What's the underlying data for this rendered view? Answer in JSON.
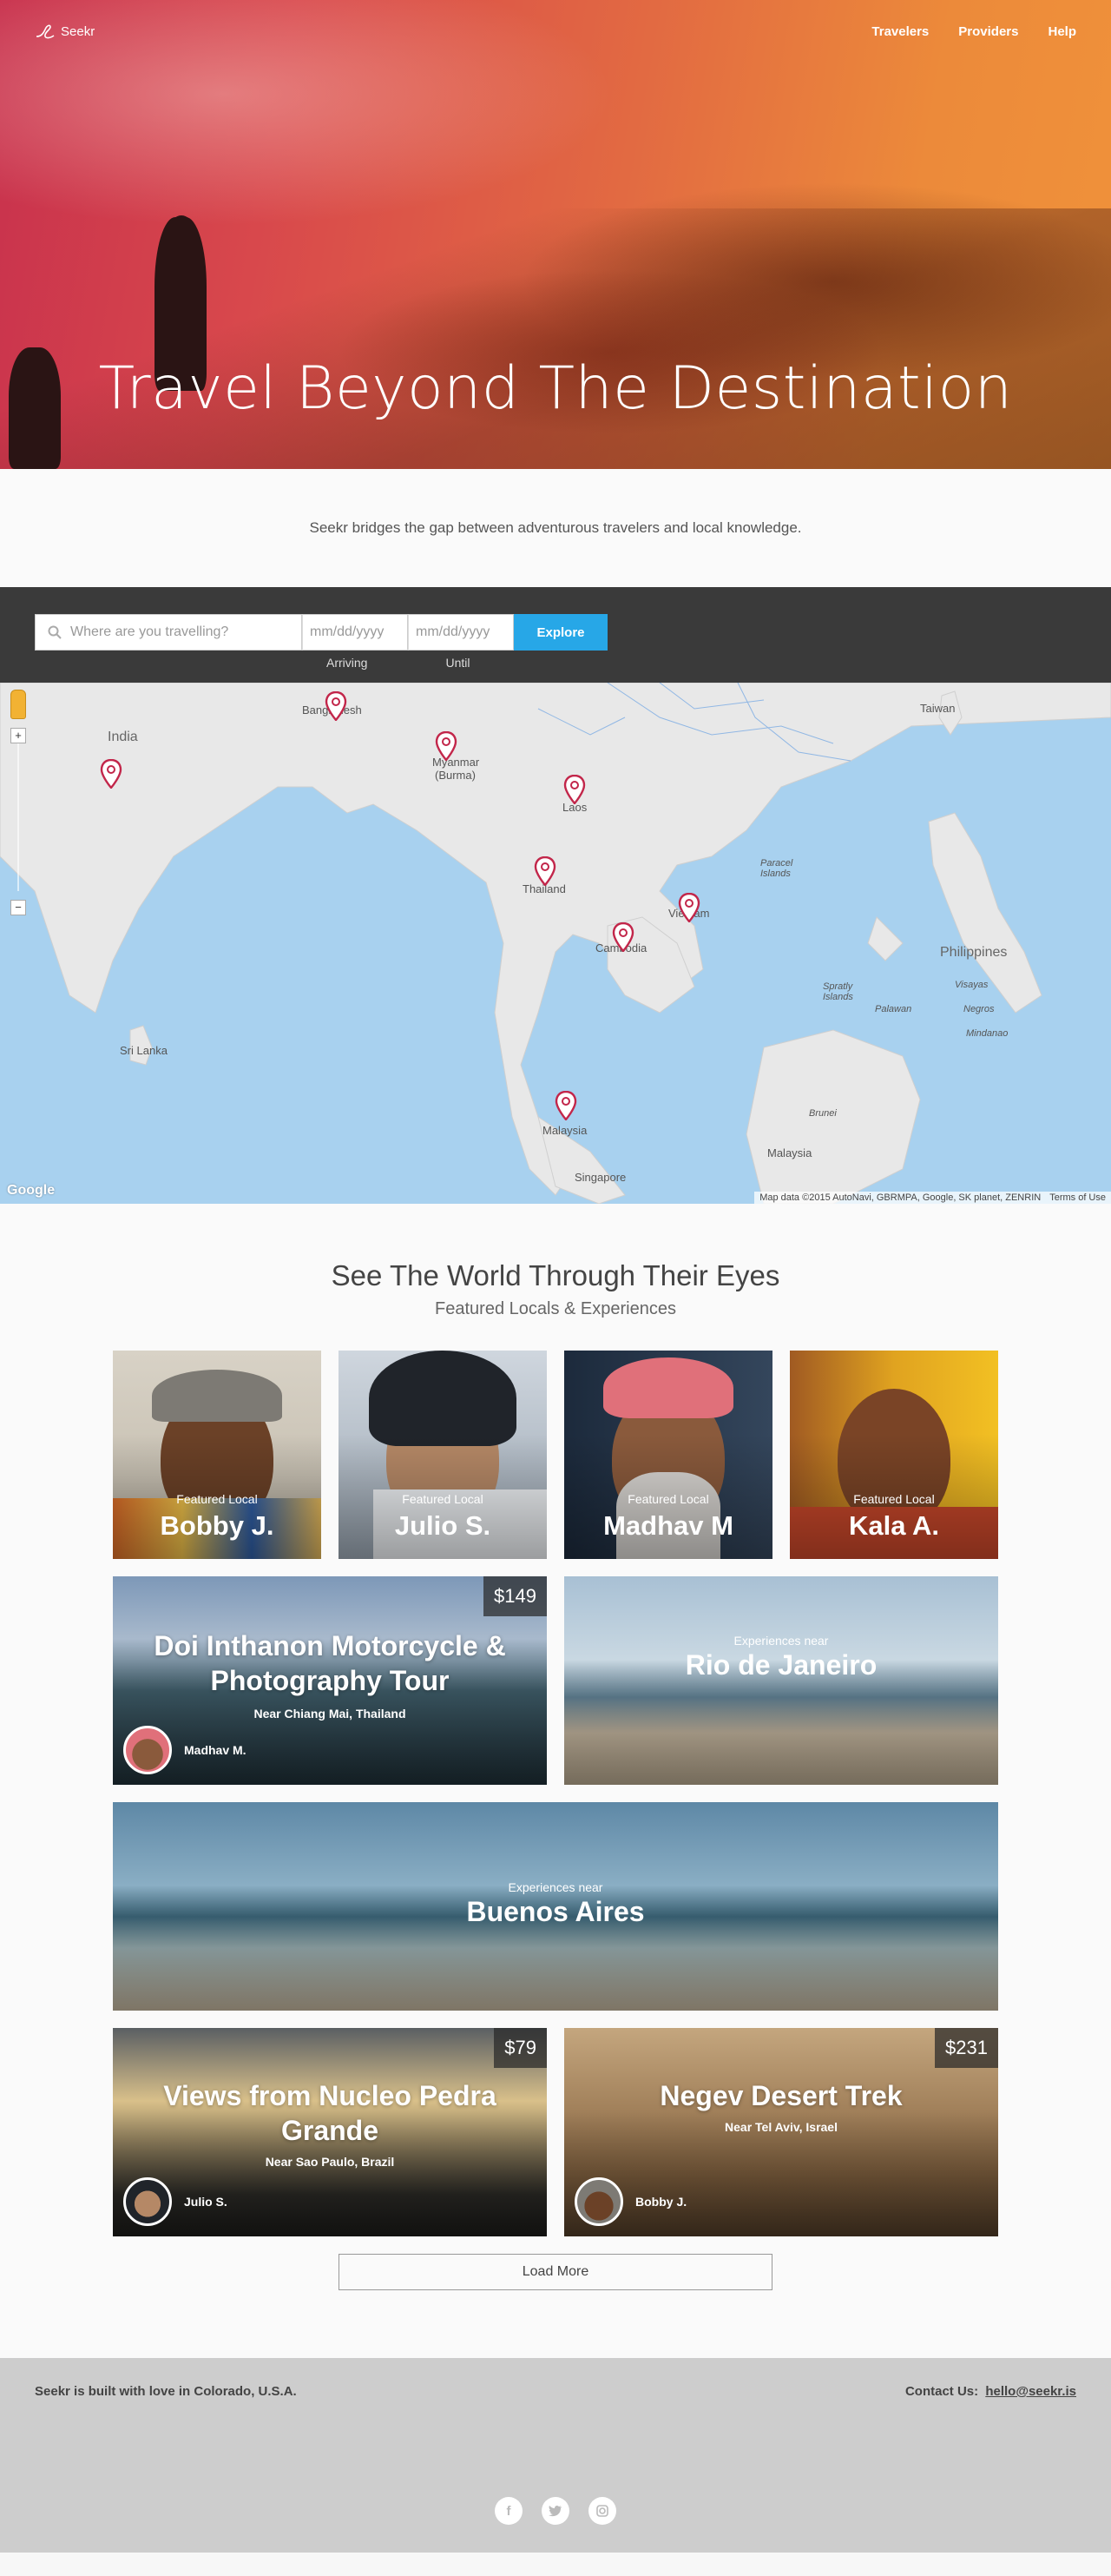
{
  "nav": {
    "logo_text": "Seekr",
    "links": [
      "Travelers",
      "Providers",
      "Help"
    ]
  },
  "hero": {
    "title": "Travel Beyond The Destination"
  },
  "intro": {
    "text": "Seekr bridges the gap between adventurous travelers and local knowledge."
  },
  "search": {
    "placeholder": "Where are you travelling?",
    "arriving_placeholder": "mm/dd/yyyy",
    "until_placeholder": "mm/dd/yyyy",
    "arriving_label": "Arriving",
    "until_label": "Until",
    "button_label": "Explore"
  },
  "map": {
    "labels": {
      "india": "India",
      "bangladesh": "Bangladesh",
      "myanmar": "Myanmar",
      "burma": "(Burma)",
      "laos": "Laos",
      "thailand": "Thailand",
      "vietnam": "Vietnam",
      "cambodia": "Cambodia",
      "taiwan": "Taiwan",
      "paracel": "Paracel Islands",
      "philippines": "Philippines",
      "visayas": "Visayas",
      "negros": "Negros",
      "mindanao": "Mindanao",
      "spratly": "Spratly Islands",
      "palawan": "Palawan",
      "srilanka": "Sri Lanka",
      "malaysia1": "Malaysia",
      "malaysia2": "Malaysia",
      "brunei": "Brunei",
      "singapore": "Singapore"
    },
    "google": "Google",
    "attribution": "Map data ©2015 AutoNavi, GBRMPA, Google, SK planet, ZENRIN",
    "terms": "Terms of Use",
    "zoom_in": "+",
    "zoom_out": "−"
  },
  "featured": {
    "title": "See The World Through Their Eyes",
    "subtitle": "Featured Locals & Experiences",
    "locals": [
      {
        "tag": "Featured Local",
        "name": "Bobby J."
      },
      {
        "tag": "Featured Local",
        "name": "Julio S."
      },
      {
        "tag": "Featured Local",
        "name": "Madhav M"
      },
      {
        "tag": "Featured Local",
        "name": "Kala A."
      }
    ],
    "exp1": {
      "price": "$149",
      "title": "Doi Inthanon Motorcycle & Photography Tour",
      "near": "Near Chiang Mai, Thailand",
      "host": "Madhav M."
    },
    "rio": {
      "tag": "Experiences near",
      "city": "Rio de Janeiro"
    },
    "buenos": {
      "tag": "Experiences near",
      "city": "Buenos Aires"
    },
    "exp2": {
      "price": "$79",
      "title": "Views from Nucleo Pedra Grande",
      "near": "Near Sao Paulo, Brazil",
      "host": "Julio S."
    },
    "exp3": {
      "price": "$231",
      "title": "Negev Desert Trek",
      "near": "Near Tel Aviv, Israel",
      "host": "Bobby J."
    },
    "load_more": "Load More"
  },
  "footer": {
    "left": "Seekr is built with love in Colorado, U.S.A.",
    "contact_label": "Contact Us:",
    "contact_email": "hello@seekr.is",
    "social": [
      "facebook-icon",
      "twitter-icon",
      "instagram-icon"
    ]
  }
}
